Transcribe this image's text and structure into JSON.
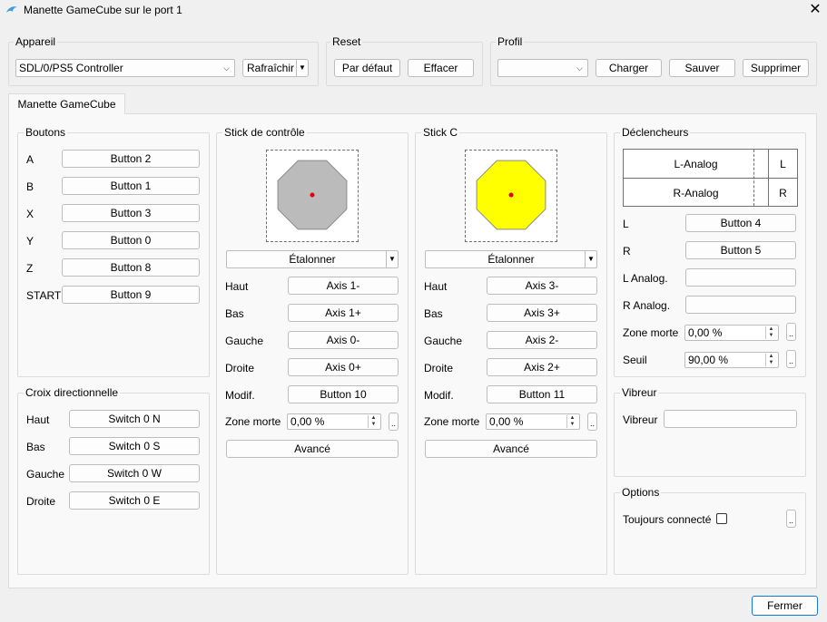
{
  "window": {
    "title": "Manette GameCube sur le port 1",
    "close_glyph": "✕"
  },
  "appareil": {
    "label": "Appareil",
    "device": "SDL/0/PS5 Controller",
    "refresh": "Rafraîchir"
  },
  "reset": {
    "label": "Reset",
    "default": "Par défaut",
    "clear": "Effacer"
  },
  "profil": {
    "label": "Profil",
    "value": "",
    "load": "Charger",
    "save": "Sauver",
    "delete": "Supprimer"
  },
  "tab": {
    "label": "Manette GameCube"
  },
  "boutons": {
    "label": "Boutons",
    "rows": [
      {
        "name": "A",
        "value": "Button 2"
      },
      {
        "name": "B",
        "value": "Button 1"
      },
      {
        "name": "X",
        "value": "Button 3"
      },
      {
        "name": "Y",
        "value": "Button 0"
      },
      {
        "name": "Z",
        "value": "Button 8"
      },
      {
        "name": "START",
        "value": "Button 9"
      }
    ]
  },
  "dpad": {
    "label": "Croix directionnelle",
    "rows": [
      {
        "name": "Haut",
        "value": "Switch 0 N"
      },
      {
        "name": "Bas",
        "value": "Switch 0 S"
      },
      {
        "name": "Gauche",
        "value": "Switch 0 W"
      },
      {
        "name": "Droite",
        "value": "Switch 0 E"
      }
    ]
  },
  "main_stick": {
    "label": "Stick de contrôle",
    "calibrate": "Étalonner",
    "rows": [
      {
        "name": "Haut",
        "value": "Axis 1-"
      },
      {
        "name": "Bas",
        "value": "Axis 1+"
      },
      {
        "name": "Gauche",
        "value": "Axis 0-"
      },
      {
        "name": "Droite",
        "value": "Axis 0+"
      },
      {
        "name": "Modif.",
        "value": "Button 10"
      }
    ],
    "deadzone_label": "Zone morte",
    "deadzone": "0,00 %",
    "advanced": "Avancé",
    "color": "#bbbbbb"
  },
  "c_stick": {
    "label": "Stick C",
    "calibrate": "Étalonner",
    "rows": [
      {
        "name": "Haut",
        "value": "Axis 3-"
      },
      {
        "name": "Bas",
        "value": "Axis 3+"
      },
      {
        "name": "Gauche",
        "value": "Axis 2-"
      },
      {
        "name": "Droite",
        "value": "Axis 2+"
      },
      {
        "name": "Modif.",
        "value": "Button 11"
      }
    ],
    "deadzone_label": "Zone morte",
    "deadzone": "0,00 %",
    "advanced": "Avancé",
    "color": "#ffff00"
  },
  "triggers": {
    "label": "Déclencheurs",
    "table": [
      {
        "name": "L-Analog",
        "key": "L"
      },
      {
        "name": "R-Analog",
        "key": "R"
      }
    ],
    "rows": [
      {
        "name": "L",
        "value": "Button 4"
      },
      {
        "name": "R",
        "value": "Button 5"
      },
      {
        "name": "L Analog.",
        "value": ""
      },
      {
        "name": "R Analog.",
        "value": ""
      }
    ],
    "deadzone_label": "Zone morte",
    "deadzone": "0,00 %",
    "threshold_label": "Seuil",
    "threshold": "90,00 %"
  },
  "rumble": {
    "label": "Vibreur",
    "row_label": "Vibreur",
    "value": ""
  },
  "options": {
    "label": "Options",
    "always_connected": "Toujours connecté"
  },
  "more": "..",
  "close": "Fermer",
  "accent": "#1a73d9",
  "dot_color": "#e00000"
}
